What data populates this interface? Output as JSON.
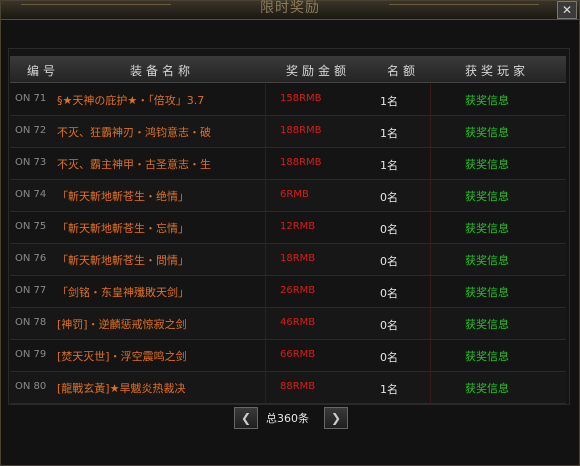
{
  "window": {
    "title": "限时奖励"
  },
  "table": {
    "headers": [
      "编号",
      "装备名称",
      "奖励金额",
      "名额",
      "获奖玩家"
    ],
    "rows": [
      {
        "no": "ON 71",
        "name": "§★天神の庇护★・「倍攻」3.7",
        "amount": "158RMB",
        "count": "1名",
        "info": "获奖信息"
      },
      {
        "no": "ON 72",
        "name": "不灭、狂霸神刃・鸿钧意志・破",
        "amount": "188RMB",
        "count": "1名",
        "info": "获奖信息"
      },
      {
        "no": "ON 73",
        "name": "不灭、霸主神甲・古圣意志・生",
        "amount": "188RMB",
        "count": "1名",
        "info": "获奖信息"
      },
      {
        "no": "ON 74",
        "name": "「斬天斬地斬苍生・绝情」",
        "amount": "6RMB",
        "count": "0名",
        "info": "获奖信息"
      },
      {
        "no": "ON 75",
        "name": "「斬天斬地斬苍生・忘情」",
        "amount": "12RMB",
        "count": "0名",
        "info": "获奖信息"
      },
      {
        "no": "ON 76",
        "name": "「斬天斬地斬苍生・問情」",
        "amount": "18RMB",
        "count": "0名",
        "info": "获奖信息"
      },
      {
        "no": "ON 77",
        "name": "「剑铭・东皇神殲敗天剑」",
        "amount": "26RMB",
        "count": "0名",
        "info": "获奖信息"
      },
      {
        "no": "ON 78",
        "name": "[神罚]・逆麟惩戒惊寂之剑",
        "amount": "46RMB",
        "count": "0名",
        "info": "获奖信息"
      },
      {
        "no": "ON 79",
        "name": "[焚天灭世]・浮空震鸣之剑",
        "amount": "66RMB",
        "count": "0名",
        "info": "获奖信息"
      },
      {
        "no": "ON 80",
        "name": "[龍戰玄黃]★旱魃炎热裁决",
        "amount": "88RMB",
        "count": "1名",
        "info": "获奖信息"
      }
    ]
  },
  "pager": {
    "total": "总360条",
    "prev_icon": "chevron-left-icon",
    "next_icon": "chevron-right-icon"
  }
}
